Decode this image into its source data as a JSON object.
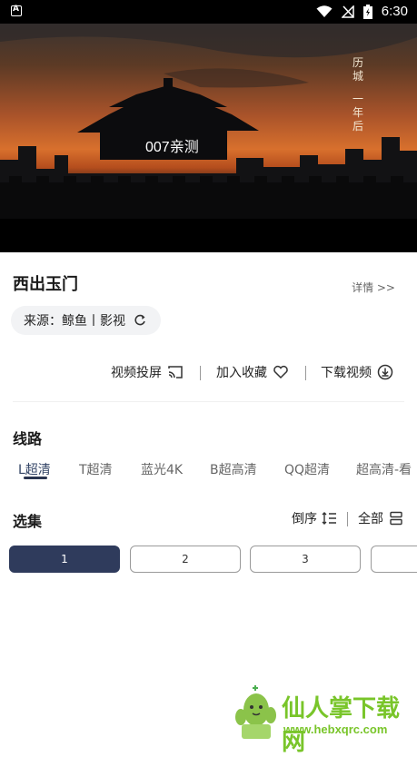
{
  "status_bar": {
    "time": "6:30",
    "app_indicator": "A"
  },
  "video": {
    "overlay_label": "007亲测",
    "calligraphy_col1": "历城",
    "calligraphy_col2": "一年后"
  },
  "content": {
    "title": "西出玉门",
    "details_link": "详情 >>",
    "source_label": "来源：鲸鱼丨影视"
  },
  "actions": {
    "cast": "视频投屏",
    "favorite": "加入收藏",
    "download": "下载视频"
  },
  "routes": {
    "title": "线路",
    "tabs": [
      "L超清",
      "T超清",
      "蓝光4K",
      "B超高清",
      "QQ超清",
      "超高清-看"
    ],
    "active_index": 0
  },
  "episodes": {
    "title": "选集",
    "order_label": "倒序",
    "all_label": "全部",
    "items": [
      "1",
      "2",
      "3",
      ""
    ],
    "active_index": 0
  },
  "watermark": {
    "name": "仙人掌下载网",
    "url": "www.hebxqrc.com"
  },
  "colors": {
    "accent": "#2f3b5c",
    "watermark_green": "#79c52a"
  }
}
